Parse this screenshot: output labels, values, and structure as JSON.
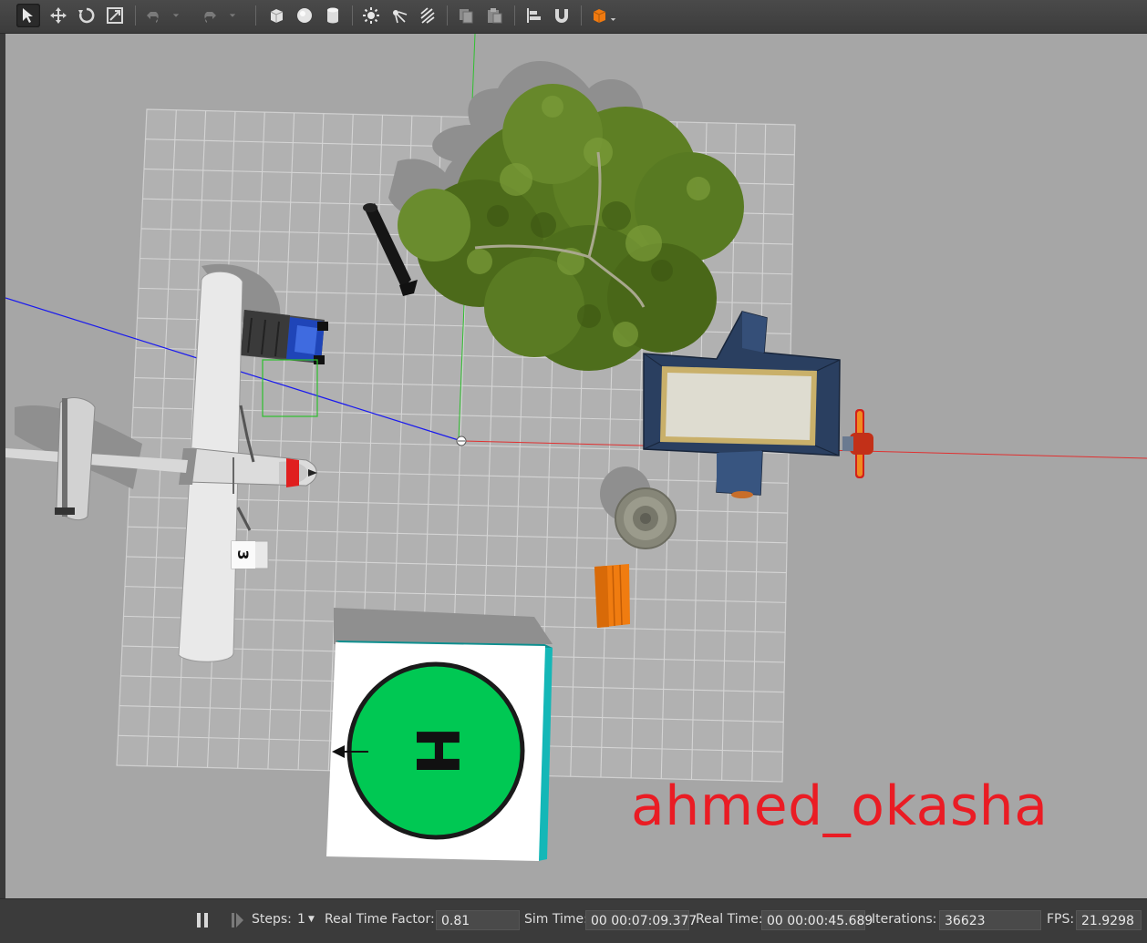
{
  "toolbar": {
    "tools": [
      "select-mode",
      "translate-mode",
      "rotate-mode",
      "scale-mode",
      "undo",
      "redo",
      "box",
      "sphere",
      "cylinder",
      "point-light",
      "spot-light",
      "directional-light",
      "copy",
      "paste",
      "align",
      "snap",
      "view-angle"
    ]
  },
  "scene": {
    "watermark": "ahmed_okasha",
    "box_label": "3",
    "helipad_letter": "H"
  },
  "statusbar": {
    "steps_label": "Steps:",
    "steps_value": "1",
    "rtf_label": "Real Time Factor:",
    "rtf_value": "0.81",
    "sim_time_label": "Sim Time:",
    "sim_time_value": "00 00:07:09.377",
    "real_time_label": "Real Time:",
    "real_time_value": "00 00:00:45.689",
    "iterations_label": "Iterations:",
    "iterations_value": "36623",
    "fps_label": "FPS:",
    "fps_value": "21.9298"
  },
  "colors": {
    "ground": "#a6a6a6",
    "grid": "#d3d3d3",
    "helipad_green": "#00c853",
    "watermark": "#ea1c24",
    "x_axis": "#e03030",
    "y_axis": "#30c030",
    "z_axis": "#1a1aee"
  }
}
